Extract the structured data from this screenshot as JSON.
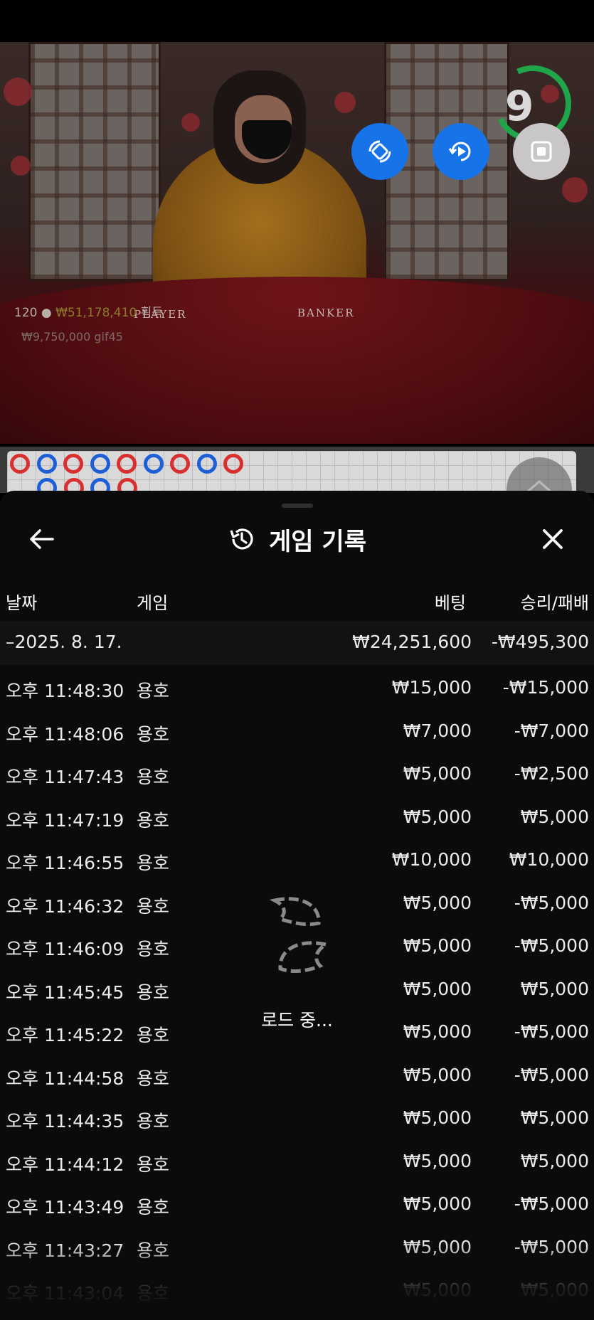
{
  "video": {
    "table_player_label": "PLAYER",
    "table_banker_label": "BANKER",
    "timer": "9",
    "players": "120",
    "winnings": "₩51,178,410",
    "winnings_suffix": "획득",
    "ticker": "₩9,750,000  gif45"
  },
  "roadmap": {
    "row1": [
      "r",
      "b",
      "r",
      "b",
      "r",
      "b",
      "r",
      "b",
      "r"
    ],
    "row2": [
      "b",
      "r",
      "b",
      "r"
    ]
  },
  "sheet": {
    "title": "게임 기록",
    "columns": {
      "date": "날짜",
      "game": "게임",
      "bet": "베팅",
      "result": "승리/패배"
    },
    "date_group": {
      "label": "–2025. 8. 17.",
      "bet": "₩24,251,600",
      "result": "-₩495,300"
    },
    "rows": [
      {
        "time": "오후 11:48:30",
        "game": "용호",
        "bet": "₩15,000",
        "result": "-₩15,000"
      },
      {
        "time": "오후 11:48:06",
        "game": "용호",
        "bet": "₩7,000",
        "result": "-₩7,000"
      },
      {
        "time": "오후 11:47:43",
        "game": "용호",
        "bet": "₩5,000",
        "result": "-₩2,500"
      },
      {
        "time": "오후 11:47:19",
        "game": "용호",
        "bet": "₩5,000",
        "result": "₩5,000"
      },
      {
        "time": "오후 11:46:55",
        "game": "용호",
        "bet": "₩10,000",
        "result": "₩10,000"
      },
      {
        "time": "오후 11:46:32",
        "game": "용호",
        "bet": "₩5,000",
        "result": "-₩5,000"
      },
      {
        "time": "오후 11:46:09",
        "game": "용호",
        "bet": "₩5,000",
        "result": "-₩5,000"
      },
      {
        "time": "오후 11:45:45",
        "game": "용호",
        "bet": "₩5,000",
        "result": "₩5,000"
      },
      {
        "time": "오후 11:45:22",
        "game": "용호",
        "bet": "₩5,000",
        "result": "-₩5,000"
      },
      {
        "time": "오후 11:44:58",
        "game": "용호",
        "bet": "₩5,000",
        "result": "-₩5,000"
      },
      {
        "time": "오후 11:44:35",
        "game": "용호",
        "bet": "₩5,000",
        "result": "₩5,000"
      },
      {
        "time": "오후 11:44:12",
        "game": "용호",
        "bet": "₩5,000",
        "result": "₩5,000"
      },
      {
        "time": "오후 11:43:49",
        "game": "용호",
        "bet": "₩5,000",
        "result": "-₩5,000"
      },
      {
        "time": "오후 11:43:27",
        "game": "용호",
        "bet": "₩5,000",
        "result": "-₩5,000"
      },
      {
        "time": "오후 11:43:04",
        "game": "용호",
        "bet": "₩5,000",
        "result": "₩5,000"
      }
    ],
    "loading_text": "로드 중..."
  }
}
